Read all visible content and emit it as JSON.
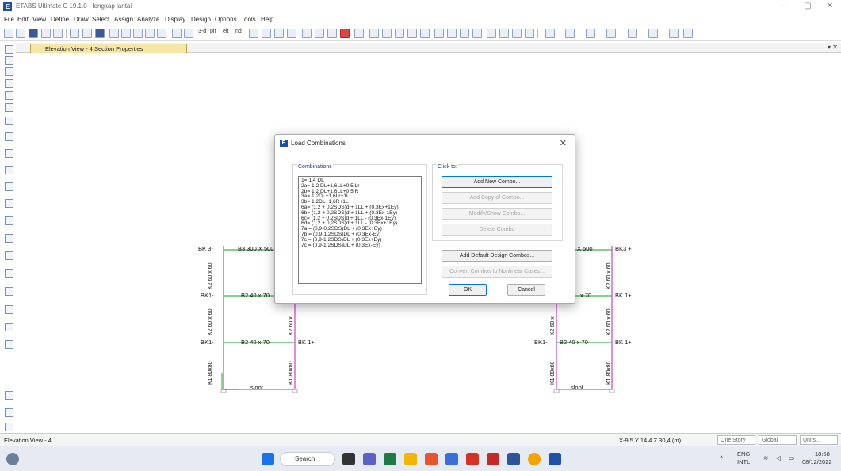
{
  "window": {
    "title": "ETABS Ultimate C 19.1.0 - lengkap lantai",
    "minimize": "—",
    "maximize": "▢",
    "close": "✕"
  },
  "menu": [
    "File",
    "Edit",
    "View",
    "Define",
    "Draw",
    "Select",
    "Assign",
    "Analyze",
    "Display",
    "Design",
    "Options",
    "Tools",
    "Help"
  ],
  "toolbar": {
    "labels": [
      "3-d",
      "plt",
      "elt",
      "nd"
    ]
  },
  "tab": {
    "label": "Elevation View - 4  Section Properties",
    "close": "▾ ✕"
  },
  "elevation": {
    "beams_left": [
      {
        "left": "BK 3-",
        "mid": "B3 300 X 500"
      },
      {
        "left": "BK1-",
        "mid": "B2 40 x 70"
      },
      {
        "left": "BK1-",
        "mid": "B2 40 x 70",
        "right": "BK 1+"
      }
    ],
    "beams_right": [
      {
        "mid": "X 500",
        "right": "BK3 +"
      },
      {
        "mid": "x 70",
        "right": "BK 1+"
      },
      {
        "left": "BK1-",
        "mid": "B2 40 x 70",
        "right": "BK 1+"
      }
    ],
    "columns": [
      "K2 60 x 60",
      "K2 60 x 60",
      "K1 80x80",
      "K1 80x80",
      "K2 60 x",
      "K2 60 x 60",
      "K2 60 x",
      "K2 60 x 60",
      "K1 80x80",
      "K1 80x80"
    ],
    "sloof": "sloof"
  },
  "dialog": {
    "title": "Load Combinations",
    "close": "✕",
    "combinations_label": "Combinations",
    "click_to_label": "Click to:",
    "combos": [
      "1= 1,4 DL",
      "2a= 1,2 DL+1,6LL+0,5 Lr",
      "2b= 1,2 DL+1,6LL+0,5 R",
      "3a= 1,2DL+1,6Lr+1L",
      "3b= 1,2DL+1,6R+1L",
      "6a= (1,2 + 0,2SDS)d + 1LL + (0.3Ex+1Ey)",
      "6b= (1,2 + 0,2SDS)d + 1LL + (0.3Ex-1Ey)",
      "6c= (1,2 + 0,2SDS)d + 1LL - (0.3Ex-1Ey)",
      "6d= (1,2 + 0,2SDS)d + 1LL - (0.3Ex+1Ey)",
      "7a = (0,9-0,2SDS)DL + (0,3Ex+Ey)",
      "7b = (0,9-1,2SDS)DL + (0,3Ex-Ey)",
      "7c = (0,9-1,2SDS)DL + (0,3Ex+Ey)",
      "7c = (0,9-1,2SDS)DL + (0,3Ex-Ey)"
    ],
    "buttons": {
      "add_new": "Add New Combo...",
      "add_copy": "Add Copy of Combo...",
      "modify": "Modify/Show Combo...",
      "delete": "Delete Combo",
      "add_default": "Add Default Design Combos...",
      "convert": "Convert Combos to Nonlinear Cases...",
      "ok": "OK",
      "cancel": "Cancel"
    }
  },
  "status": {
    "view": "Elevation View - 4",
    "coords": "X-9,5  Y 14,4  Z 30,4 (m)",
    "story": "One Story",
    "global": "Global",
    "units": "Units..."
  },
  "taskbar": {
    "search": "Search",
    "lang1": "ENG",
    "lang2": "INTL",
    "time": "18:58",
    "date": "08/12/2022"
  },
  "colors": {
    "beam": "#3ab44a",
    "column": "#d23cd6",
    "dialog_accent": "#1f4fa8",
    "tab_bg": "#f7e7a6"
  }
}
